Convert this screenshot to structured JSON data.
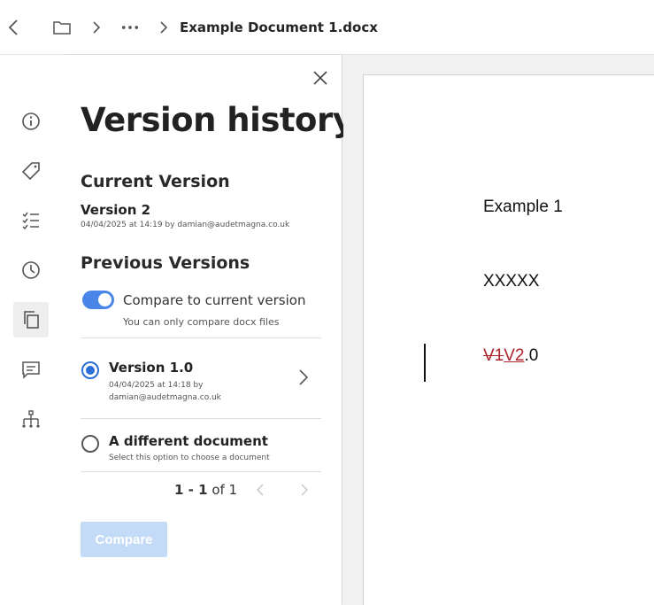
{
  "breadcrumb": {
    "back_icon": "chevron-left-icon",
    "folder_icon": "folder-icon",
    "separator_icon": "chevron-right-icon",
    "more_icon": "ellipsis-icon",
    "document_name": "Example Document 1.docx"
  },
  "rail": {
    "items": [
      {
        "name": "info-icon"
      },
      {
        "name": "tag-icon"
      },
      {
        "name": "checklist-icon"
      },
      {
        "name": "clock-icon"
      },
      {
        "name": "copy-icon",
        "active": true
      },
      {
        "name": "comment-icon"
      },
      {
        "name": "hierarchy-icon"
      }
    ]
  },
  "panel": {
    "title": "Version history",
    "current_heading": "Current Version",
    "current_version": "Version 2",
    "current_meta": "04/04/2025 at 14:19 by damian@audetmagna.co.uk",
    "previous_heading": "Previous Versions",
    "compare_toggle_label": "Compare to current version",
    "compare_toggle_on": true,
    "compare_hint": "You can only compare docx files",
    "options": [
      {
        "title": "Version 1.0",
        "meta_line1": "04/04/2025 at 14:18 by",
        "meta_line2": "damian@audetmagna.co.uk",
        "selected": true
      },
      {
        "title": "A different document",
        "meta_line1": "Select this option to choose a document",
        "selected": false
      }
    ],
    "pager": {
      "range": "1 - 1",
      "of_text": "of 1"
    },
    "compare_button": "Compare"
  },
  "document": {
    "line1": "Example 1",
    "line2": "XXXXX",
    "line3_deleted": "V1",
    "line3_inserted": "V2",
    "line3_rest": ".0"
  },
  "colors": {
    "accent": "#4a86e8",
    "radio_selected": "#2a6fd6",
    "disabled_button": "#c3dbf7",
    "track_change": "#b0222b"
  }
}
